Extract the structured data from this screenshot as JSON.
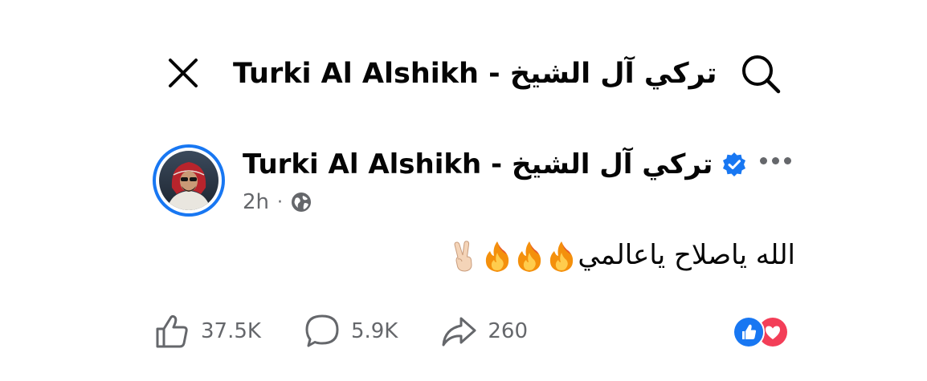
{
  "header": {
    "title": "Turki Al Alshikh - تركي آل الشيخ",
    "close_icon": "close-icon",
    "search_icon": "search-icon"
  },
  "post": {
    "author": "Turki Al Alshikh - تركي آل الشيخ",
    "verified": true,
    "time": "2h",
    "separator": "·",
    "audience_icon": "globe-icon",
    "more_icon": "more-options-icon",
    "text": "الله ياصلاح ياعالمي",
    "emojis": [
      "fire",
      "fire",
      "fire",
      "victory-hand"
    ]
  },
  "actions": {
    "likes": "37.5K",
    "comments": "5.9K",
    "shares": "260"
  },
  "reactions": [
    "like",
    "love"
  ],
  "colors": {
    "accent": "#1877f2",
    "love": "#f33e58",
    "secondary_text": "#65676b"
  }
}
